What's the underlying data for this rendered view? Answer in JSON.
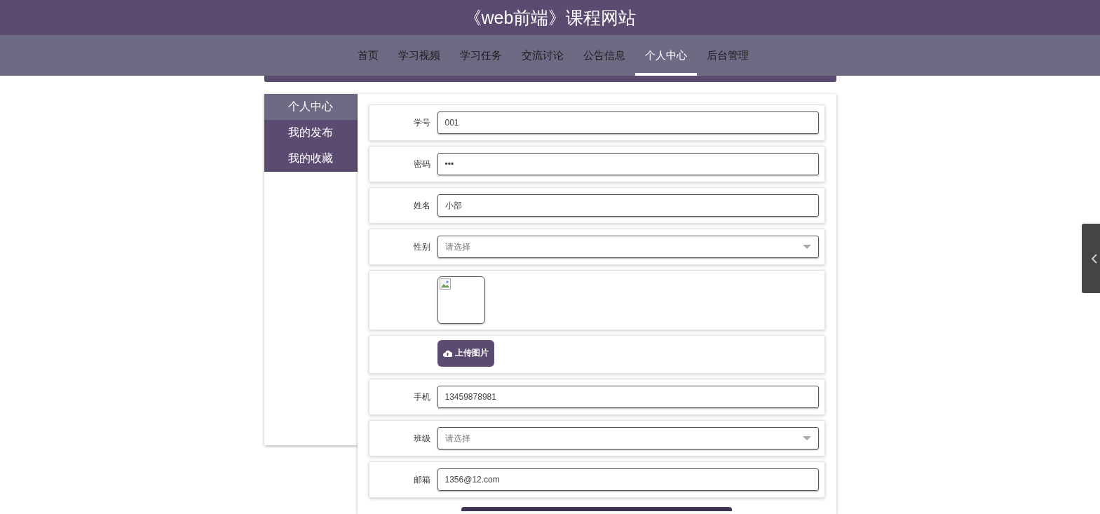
{
  "site_title": "《web前端》课程网站",
  "nav": [
    {
      "label": "首页",
      "selected": false
    },
    {
      "label": "学习视频",
      "selected": false
    },
    {
      "label": "学习任务",
      "selected": false
    },
    {
      "label": "交流讨论",
      "selected": false
    },
    {
      "label": "公告信息",
      "selected": false
    },
    {
      "label": "个人中心",
      "selected": true
    },
    {
      "label": "后台管理",
      "selected": false
    }
  ],
  "sidebar": {
    "items": [
      {
        "label": "个人中心",
        "selected": true
      },
      {
        "label": "我的发布",
        "selected": false
      },
      {
        "label": "我的收藏",
        "selected": false
      }
    ]
  },
  "form": {
    "fields": [
      {
        "kind": "text",
        "label": "学号",
        "value": "001"
      },
      {
        "kind": "text",
        "label": "密码",
        "value": "•••"
      },
      {
        "kind": "text",
        "label": "姓名",
        "value": "小部"
      },
      {
        "kind": "select",
        "label": "性别",
        "placeholder": "请选择"
      },
      {
        "kind": "image"
      },
      {
        "kind": "upload",
        "button": "上传图片"
      },
      {
        "kind": "text",
        "label": "手机",
        "value": "13459878981"
      },
      {
        "kind": "select",
        "label": "班级",
        "placeholder": "请选择"
      },
      {
        "kind": "text",
        "label": "邮箱",
        "value": "1356@12.com"
      }
    ]
  }
}
